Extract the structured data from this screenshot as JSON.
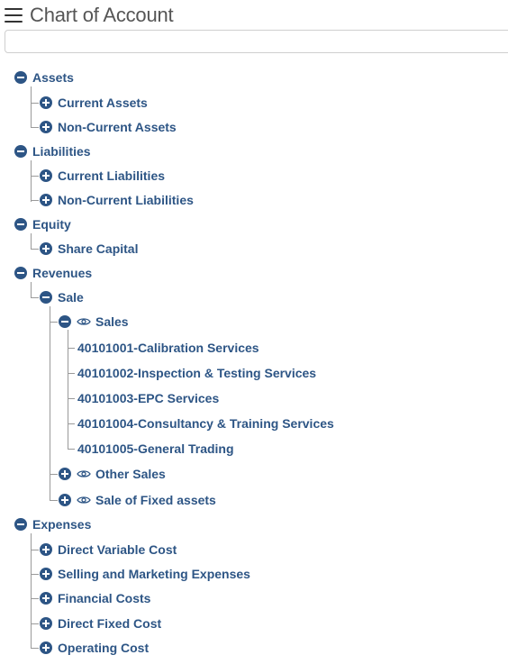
{
  "header": {
    "title": "Chart of Account"
  },
  "search": {
    "value": "",
    "placeholder": ""
  },
  "tree": {
    "assets": {
      "label": "Assets",
      "expanded": true
    },
    "current_assets": {
      "label": "Current Assets",
      "expanded": false
    },
    "non_current_assets": {
      "label": "Non-Current Assets",
      "expanded": false
    },
    "liabilities": {
      "label": "Liabilities",
      "expanded": true
    },
    "current_liabilities": {
      "label": "Current Liabilities",
      "expanded": false
    },
    "non_current_liabilities": {
      "label": "Non-Current Liabilities",
      "expanded": false
    },
    "equity": {
      "label": "Equity",
      "expanded": true
    },
    "share_capital": {
      "label": "Share Capital",
      "expanded": false
    },
    "revenues": {
      "label": "Revenues",
      "expanded": true
    },
    "sale": {
      "label": "Sale",
      "expanded": true
    },
    "sales": {
      "label": "Sales",
      "expanded": true,
      "has_eye_icon": true
    },
    "accounts": [
      "40101001-Calibration Services",
      "40101002-Inspection & Testing Services",
      "40101003-EPC Services",
      "40101004-Consultancy & Training Services",
      "40101005-General Trading"
    ],
    "other_sales": {
      "label": "Other Sales",
      "expanded": false,
      "has_eye_icon": true
    },
    "sale_fixed_assets": {
      "label": "Sale of Fixed assets",
      "expanded": false,
      "has_eye_icon": true
    },
    "expenses": {
      "label": "Expenses",
      "expanded": true
    },
    "direct_variable_cost": {
      "label": "Direct Variable Cost",
      "expanded": false
    },
    "selling_marketing": {
      "label": "Selling and Marketing Expenses",
      "expanded": false
    },
    "financial_costs": {
      "label": "Financial Costs",
      "expanded": false
    },
    "direct_fixed_cost": {
      "label": "Direct Fixed Cost",
      "expanded": false
    },
    "operating_cost": {
      "label": "Operating Cost",
      "expanded": false
    }
  },
  "colors": {
    "node_text": "#2d5585",
    "toggle_fill": "#2d5585",
    "connector": "#9a9a9a"
  }
}
